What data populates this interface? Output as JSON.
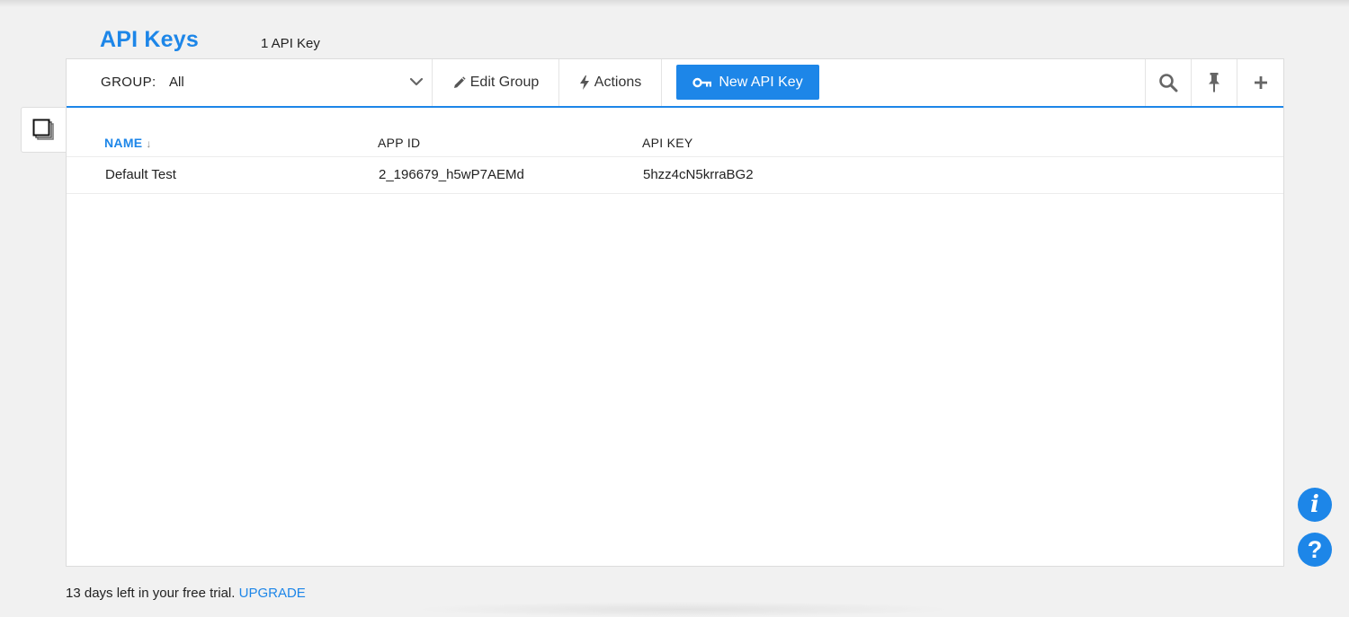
{
  "header": {
    "title": "API Keys",
    "count_label": "1 API Key"
  },
  "toolbar": {
    "group_label": "GROUP:",
    "group_value": "All",
    "edit_group_label": "Edit Group",
    "actions_label": "Actions",
    "new_key_label": "New API Key"
  },
  "table": {
    "columns": [
      "NAME",
      "APP ID",
      "API KEY"
    ],
    "sort_indicator": "↓",
    "rows": [
      {
        "name": "Default Test",
        "app_id": "2_196679_h5wP7AEMd",
        "api_key": "5hzz4cN5krraBG2"
      }
    ]
  },
  "footer": {
    "trial_text": "13 days left in your free trial.",
    "upgrade_label": "UPGRADE"
  },
  "floating": {
    "info_glyph": "i",
    "help_glyph": "?"
  },
  "colors": {
    "accent": "#1d86e8",
    "background": "#f1f1f1",
    "panel": "#ffffff"
  }
}
